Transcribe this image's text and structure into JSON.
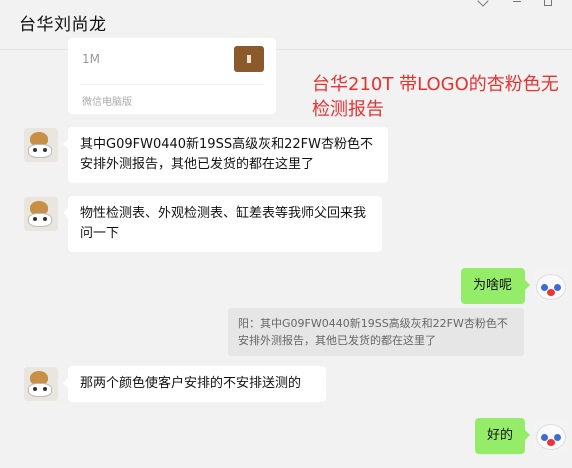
{
  "header": {
    "title": "台华刘尚龙"
  },
  "file_card": {
    "size": "1M",
    "source": "微信电脑版",
    "icon": "archive-file-icon"
  },
  "annotation": {
    "text": "台华210T 带LOGO的杏粉色无检测报告",
    "color": "#e53333"
  },
  "messages": [
    {
      "side": "left",
      "text": "其中G09FW0440新19SS高级灰和22FW杏粉色不安排外测报告，其他已发货的都在这里了"
    },
    {
      "side": "left",
      "text": "物性检测表、外观检测表、缸差表等我师父回来我问一下"
    },
    {
      "side": "right",
      "text": "为啥呢"
    },
    {
      "side": "quote",
      "text": "阳：其中G09FW0440新19SS高级灰和22FW杏粉色不安排外测报告，其他已发货的都在这里了"
    },
    {
      "side": "left",
      "text": "那两个颜色使客户安排的不安排送测的"
    },
    {
      "side": "right",
      "text": "好的"
    }
  ],
  "colors": {
    "outgoing_bubble": "#95ec69",
    "incoming_bubble": "#ffffff",
    "background": "#f2f2f2"
  }
}
